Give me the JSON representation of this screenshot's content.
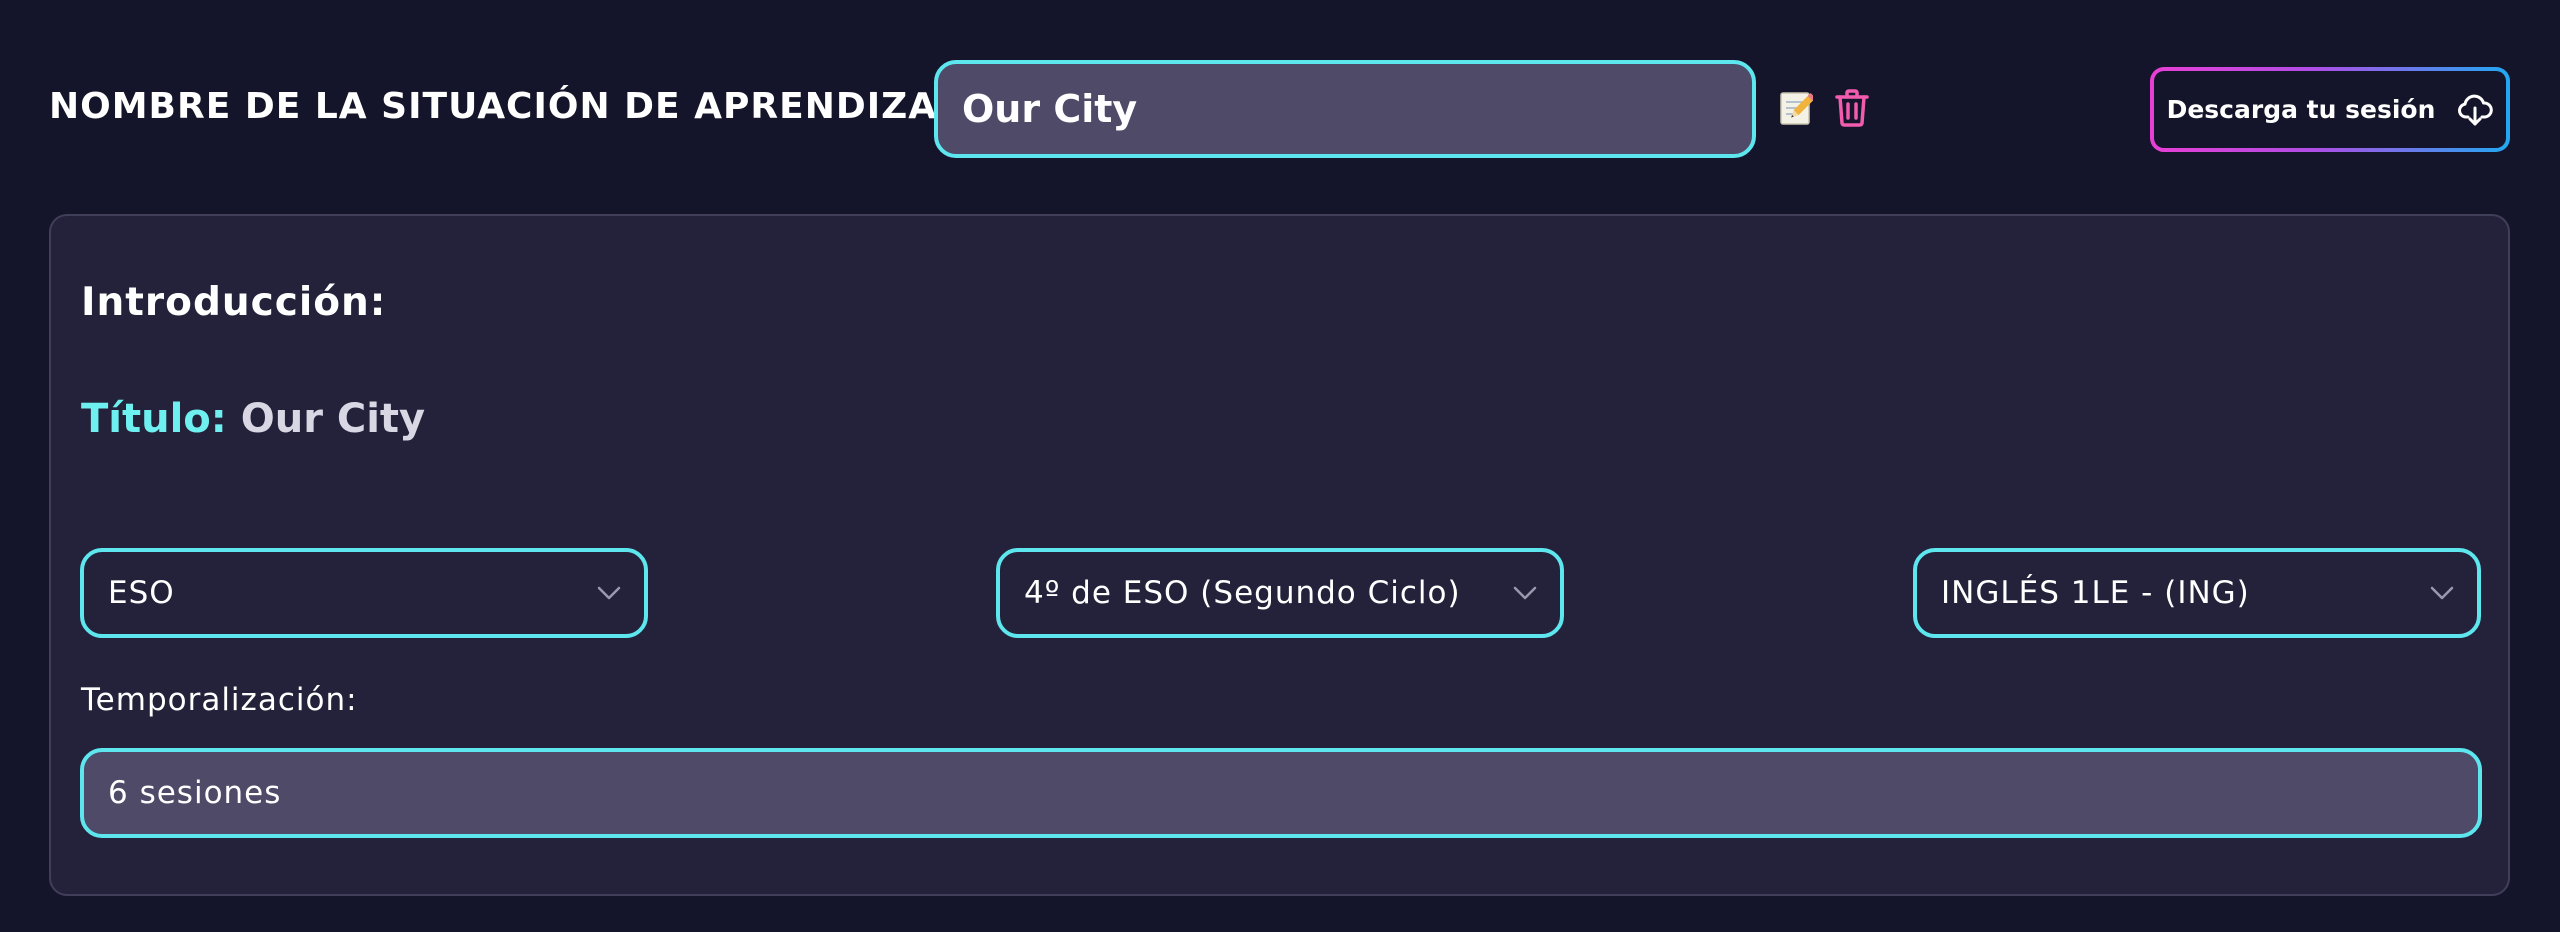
{
  "header": {
    "sa_label": "NOMBRE DE LA SITUACIÓN DE APRENDIZAJE:",
    "sa_name_value": "Our City",
    "edit_icon": "pencil-memo-icon",
    "delete_icon": "trash-icon",
    "download_label": "Descarga tu sesión",
    "download_icon": "cloud-download-icon"
  },
  "panel": {
    "intro_heading": "Introducción:",
    "title_label": "Título:",
    "title_value": "Our City",
    "selects": [
      {
        "value": "ESO"
      },
      {
        "value": "4º de ESO (Segundo Ciclo)"
      },
      {
        "value": "INGLÉS 1LE - (ING)"
      }
    ],
    "temporalizacion_label": "Temporalización:",
    "temporalizacion_value": "6 sesiones"
  },
  "colors": {
    "background": "#14142a",
    "panel": "#24223a",
    "accent_cyan": "#5ee6ee",
    "title_cyan": "#6ff0f0",
    "trash_pink": "#f25cae",
    "gradient_start": "#e83fd4",
    "gradient_end": "#22a8f0"
  }
}
